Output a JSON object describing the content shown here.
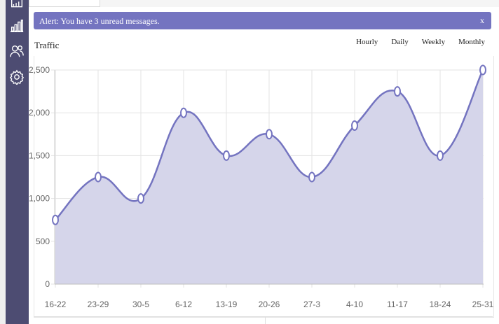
{
  "sidebar": {
    "icons": [
      "reports-icon",
      "bar-chart-icon",
      "users-icon",
      "settings-icon"
    ]
  },
  "alert": {
    "text": "Alert: You have 3 unread messages.",
    "close_label": "x"
  },
  "panel": {
    "title": "Traffic",
    "periods": [
      "Hourly",
      "Daily",
      "Weekly",
      "Monthly"
    ]
  },
  "colors": {
    "sidebar": "#4d4c72",
    "accent": "#7474c0",
    "area_fill": "#d5d5ea",
    "line": "#7474c0"
  },
  "chart_data": {
    "type": "area",
    "categories": [
      "16-22",
      "23-29",
      "30-5",
      "6-12",
      "13-19",
      "20-26",
      "27-3",
      "4-10",
      "11-17",
      "18-24",
      "25-31"
    ],
    "values": [
      750,
      1250,
      1000,
      2000,
      1500,
      1750,
      1250,
      1850,
      2250,
      1500,
      2500
    ],
    "ylim": [
      0,
      2500
    ],
    "yticks": [
      0,
      500,
      1000,
      1500,
      2000,
      2500
    ],
    "ytick_labels": [
      "0",
      "500",
      "1,000",
      "1,500",
      "2,000",
      "2,500"
    ],
    "grid": true,
    "title": "",
    "xlabel": "",
    "ylabel": ""
  }
}
